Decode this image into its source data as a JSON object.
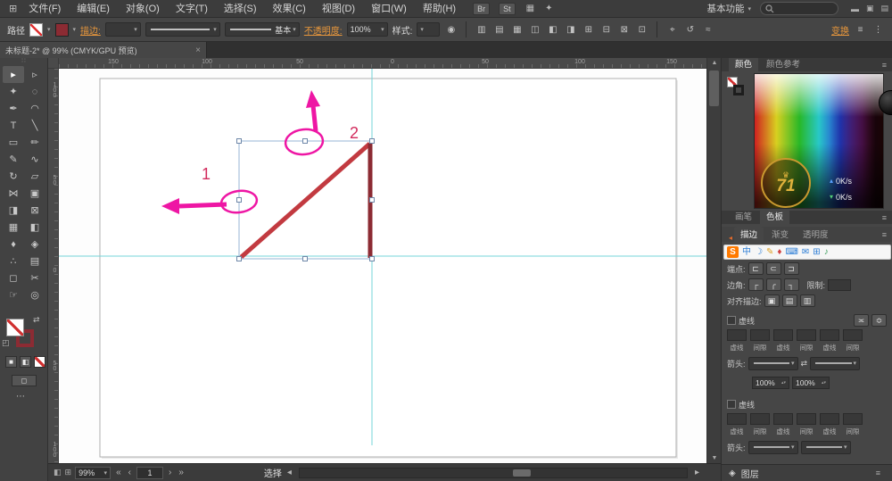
{
  "colors": {
    "accent_orange": "#e8973c",
    "annotation_magenta": "#ee16a4",
    "path_red": "#c23a40",
    "path_dark_red": "#8c2b33",
    "guide_cyan": "#74d4d8",
    "label_red": "#d22a5c"
  },
  "icons": {
    "chev": "▾",
    "menu": "≡",
    "recolor": "◉",
    "search": "⌕"
  },
  "menubar": {
    "app_icon": "⊞",
    "items": [
      "文件(F)",
      "编辑(E)",
      "对象(O)",
      "文字(T)",
      "选择(S)",
      "效果(C)",
      "视图(D)",
      "窗口(W)",
      "帮助(H)"
    ],
    "br": "Br",
    "st": "St",
    "arrange_icon": "▦",
    "tool_icon": "✦",
    "workspace": "基本功能",
    "window_icons": [
      "▬",
      "▣",
      "▤"
    ]
  },
  "controlbar": {
    "selection_type": "路径",
    "stroke_label": "描边:",
    "brush_value": "基本",
    "opacity_label": "不透明度:",
    "opacity_value": "100%",
    "style_label": "样式:",
    "transform_label": "变换",
    "align_icons": [
      "▥",
      "▤",
      "▦",
      "◫",
      "◧",
      "◨",
      "⊞",
      "⊟",
      "⊠",
      "⊡"
    ],
    "extra_icons": [
      "⌖",
      "↺",
      "≈"
    ],
    "end_icons": [
      "≡",
      "⋮"
    ]
  },
  "tabbar": {
    "doc_title": "未标题-2* @ 99% (CMYK/GPU 预览)",
    "close": "×"
  },
  "toolbar": {
    "grip": "∷",
    "tools": [
      {
        "name": "selection",
        "icon": "▸"
      },
      {
        "name": "direct-selection",
        "icon": "▹"
      },
      {
        "name": "magic-wand",
        "icon": "✦"
      },
      {
        "name": "lasso",
        "icon": "◌"
      },
      {
        "name": "pen",
        "icon": "✒"
      },
      {
        "name": "curvature",
        "icon": "◠"
      },
      {
        "name": "type",
        "icon": "T"
      },
      {
        "name": "line",
        "icon": "╲"
      },
      {
        "name": "rectangle",
        "icon": "▭"
      },
      {
        "name": "paintbrush",
        "icon": "✏"
      },
      {
        "name": "pencil",
        "icon": "✎"
      },
      {
        "name": "shaper",
        "icon": "∿"
      },
      {
        "name": "rotate",
        "icon": "↻"
      },
      {
        "name": "scale",
        "icon": "▱"
      },
      {
        "name": "width",
        "icon": "⋈"
      },
      {
        "name": "free-transform",
        "icon": "▣"
      },
      {
        "name": "shape-builder",
        "icon": "◨"
      },
      {
        "name": "perspective-grid",
        "icon": "⊠"
      },
      {
        "name": "mesh",
        "icon": "▦"
      },
      {
        "name": "gradient",
        "icon": "◧"
      },
      {
        "name": "eyedropper",
        "icon": "♦"
      },
      {
        "name": "blend",
        "icon": "◈"
      },
      {
        "name": "symbol-sprayer",
        "icon": "∴"
      },
      {
        "name": "column-graph",
        "icon": "▤"
      },
      {
        "name": "artboard",
        "icon": "◻"
      },
      {
        "name": "slice",
        "icon": "✂"
      },
      {
        "name": "hand",
        "icon": "☞"
      },
      {
        "name": "zoom",
        "icon": "◎"
      }
    ],
    "swap_icon": "⇄",
    "default_icon": "◰",
    "color_icon": "■",
    "gradient_icon": "◧",
    "none_icon": "⊘",
    "screen_icon": "◻",
    "edit_icon": "⋯"
  },
  "rulers": {
    "top": [
      "150",
      "100",
      "50",
      "0",
      "50",
      "100",
      "150"
    ],
    "left": [
      "100",
      "50",
      "0",
      "50",
      "100"
    ]
  },
  "canvas": {
    "labels": {
      "one": "1",
      "two": "2"
    }
  },
  "statusbar": {
    "mini_icons": [
      "◧",
      "⊞"
    ],
    "zoom": "99%",
    "nav": [
      "«",
      "‹",
      "›",
      "»"
    ],
    "page": "1",
    "status": "选择",
    "scroll_left": "◂",
    "scroll_right": "▸"
  },
  "scrollbar": {
    "up": "▲",
    "down": "▼"
  },
  "panels": {
    "color": {
      "tabs": [
        "颜色",
        "颜色参考"
      ],
      "menu_icon": "≡"
    },
    "overlay": {
      "crown": "♛",
      "watermark": "71",
      "up_icon": "▴",
      "up_speed": "0K/s",
      "down_icon": "▾",
      "down_speed": "0K/s"
    },
    "library": {
      "tabs": [
        "画笔",
        "色板"
      ],
      "menu_icon": "≡"
    },
    "stroke": {
      "collapse_icon": "◂",
      "tabs": [
        "描边",
        "渐变",
        "透明度"
      ],
      "menu_icon": "≡",
      "cap_label": "端点:",
      "cap_icons": [
        "⊏",
        "⊂",
        "⊐"
      ],
      "corner_label": "边角:",
      "corner_icons": [
        "┌",
        "╭",
        "┐"
      ],
      "limit_label": "限制:",
      "align_label": "对齐描边:",
      "align_icons": [
        "▣",
        "▤",
        "▥"
      ],
      "dash_label": "虚线",
      "dash_icons": [
        "≍",
        "≎"
      ],
      "dash_cols": [
        "虚线",
        "间隙",
        "虚线",
        "间隙",
        "虚线",
        "间隙"
      ],
      "arrow_label": "箭头:",
      "swap_icon": "⇄",
      "scale": [
        "100%",
        "100%"
      ]
    },
    "stroke2": {
      "dash_label": "虚线",
      "dash_cols": [
        "虚线",
        "间隙",
        "虚线",
        "间隙",
        "虚线",
        "间隙"
      ],
      "arrow_label": "箭头:"
    },
    "layers": {
      "icon": "◈",
      "label": "图层",
      "menu_icon": "≡"
    }
  },
  "ime": {
    "logo_bg": "#ff7a00",
    "items": [
      {
        "name": "sogou-logo",
        "glyph": "S"
      },
      {
        "name": "mode-chinese",
        "glyph": "中"
      },
      {
        "name": "night-mode",
        "glyph": "☽"
      },
      {
        "name": "handwriting",
        "glyph": "✎"
      },
      {
        "name": "favorite",
        "glyph": "♦"
      },
      {
        "name": "keyboard",
        "glyph": "⌨"
      },
      {
        "name": "mail",
        "glyph": "✉"
      },
      {
        "name": "apps",
        "glyph": "⊞"
      },
      {
        "name": "sound",
        "glyph": "♪"
      }
    ]
  }
}
